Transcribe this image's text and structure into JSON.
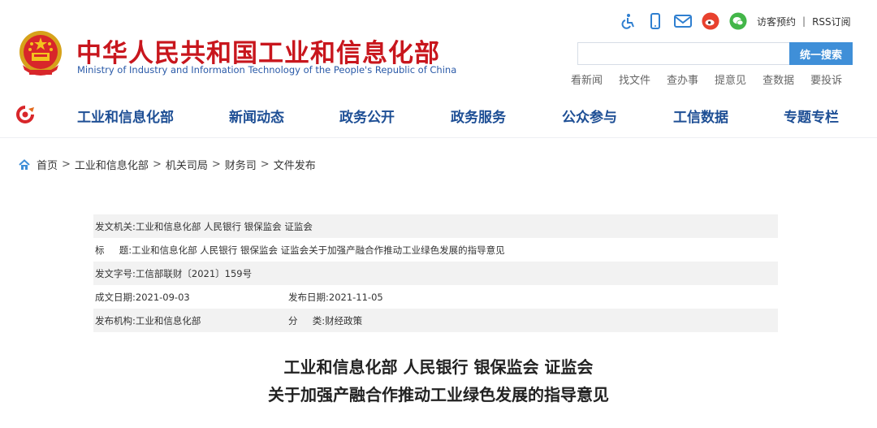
{
  "header": {
    "title_cn": "中华人民共和国工业和信息化部",
    "title_en": "Ministry of Industry and Information Technology of the People's Republic of China",
    "tools": {
      "visitor": "访客预约",
      "separator": "|",
      "rss": "RSS订阅"
    },
    "icons": [
      "accessibility-icon",
      "mobile-icon",
      "mail-icon",
      "weibo-icon",
      "wechat-icon"
    ],
    "search": {
      "placeholder": "",
      "button": "统一搜索"
    },
    "quick_links": [
      "看新闻",
      "找文件",
      "查办事",
      "提意见",
      "查数据",
      "要投诉"
    ]
  },
  "nav": {
    "items": [
      "工业和信息化部",
      "新闻动态",
      "政务公开",
      "政务服务",
      "公众参与",
      "工信数据",
      "专题专栏"
    ]
  },
  "breadcrumb": {
    "items": [
      "首页",
      "工业和信息化部",
      "机关司局",
      "财务司",
      "文件发布"
    ],
    "separator": ">"
  },
  "info": {
    "issuer_label": "发文机关:",
    "issuer": "工业和信息化部 人民银行 银保监会 证监会",
    "title_label": "标     题:",
    "title": "工业和信息化部 人民银行 银保监会 证监会关于加强产融合作推动工业绿色发展的指导意见",
    "docno_label": "发文字号:",
    "docno": "工信部联财〔2021〕159号",
    "created_label": "成文日期:",
    "created": "2021-09-03",
    "published_label": "发布日期:",
    "published": "2021-11-05",
    "org_label": "发布机构:",
    "org": "工业和信息化部",
    "category_label": "分     类:",
    "category": "财经政策"
  },
  "article": {
    "title_line1": "工业和信息化部 人民银行 银保监会 证监会",
    "title_line2": "关于加强产融合作推动工业绿色发展的指导意见"
  },
  "colors": {
    "brand_red": "#c8161d",
    "nav_blue": "#1e4f95",
    "search_blue": "#3f8fd8",
    "row_shade": "#f2f2f2"
  }
}
